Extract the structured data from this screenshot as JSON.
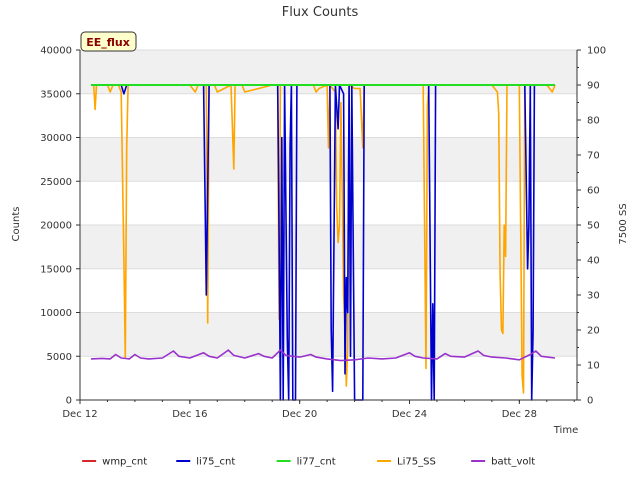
{
  "chart_data": {
    "type": "line",
    "title": "Flux Counts",
    "xlabel": "Time",
    "ylabel": "Counts",
    "y2label": "7500 SS",
    "badge": "EE_flux",
    "x_ticks": [
      "Dec 12",
      "Dec 16",
      "Dec 20",
      "Dec 24",
      "Dec 28"
    ],
    "y_ticks": [
      "0",
      "5000",
      "10000",
      "15000",
      "20000",
      "25000",
      "30000",
      "35000",
      "40000"
    ],
    "y2_ticks": [
      "0",
      "10",
      "20",
      "30",
      "40",
      "50",
      "60",
      "70",
      "80",
      "90",
      "100"
    ],
    "x_range_days": [
      "Dec 12",
      "Dec 30"
    ],
    "ylim": [
      0,
      40000
    ],
    "y2lim": [
      0,
      100
    ],
    "grid": true,
    "legend_position": "bottom",
    "series": [
      {
        "name": "wmp_cnt",
        "color": "#d62728",
        "axis": "left",
        "points": []
      },
      {
        "name": "li75_cnt",
        "color": "#0000cc",
        "axis": "left",
        "points": [
          [
            12.4,
            36000
          ],
          [
            13.5,
            36000
          ],
          [
            13.6,
            35000
          ],
          [
            13.7,
            36000
          ],
          [
            16.5,
            36000
          ],
          [
            16.6,
            12000
          ],
          [
            16.7,
            36000
          ],
          [
            19.2,
            36000
          ],
          [
            19.25,
            18500
          ],
          [
            19.3,
            0
          ],
          [
            19.35,
            30000
          ],
          [
            19.4,
            0
          ],
          [
            19.45,
            36000
          ],
          [
            19.55,
            7000
          ],
          [
            19.6,
            0
          ],
          [
            19.65,
            29000
          ],
          [
            19.7,
            36000
          ],
          [
            19.75,
            0
          ],
          [
            19.85,
            0
          ],
          [
            19.9,
            36000
          ],
          [
            21.1,
            36000
          ],
          [
            21.15,
            8000
          ],
          [
            21.2,
            1000
          ],
          [
            21.3,
            36000
          ],
          [
            21.4,
            31000
          ],
          [
            21.45,
            36000
          ],
          [
            21.6,
            35000
          ],
          [
            21.65,
            3000
          ],
          [
            21.7,
            14000
          ],
          [
            21.75,
            10000
          ],
          [
            21.8,
            36000
          ],
          [
            21.85,
            5000
          ],
          [
            21.9,
            36000
          ],
          [
            22.0,
            0
          ],
          [
            22.3,
            0
          ],
          [
            22.35,
            36000
          ],
          [
            24.7,
            36000
          ],
          [
            24.8,
            0
          ],
          [
            24.85,
            11000
          ],
          [
            24.9,
            0
          ],
          [
            24.95,
            36000
          ],
          [
            28.2,
            36000
          ],
          [
            28.3,
            15000
          ],
          [
            28.35,
            20000
          ],
          [
            28.4,
            36000
          ],
          [
            28.45,
            0
          ],
          [
            28.5,
            8000
          ],
          [
            28.55,
            36000
          ],
          [
            29.0,
            36000
          ]
        ]
      },
      {
        "name": "li77_cnt",
        "color": "#22dd22",
        "axis": "left",
        "points": [
          [
            12.4,
            36000
          ],
          [
            29.3,
            36000
          ]
        ]
      },
      {
        "name": "Li75_SS",
        "color": "#ffa500",
        "axis": "right",
        "points": [
          [
            12.4,
            90
          ],
          [
            12.5,
            90
          ],
          [
            12.55,
            83
          ],
          [
            12.6,
            90
          ],
          [
            13.0,
            90
          ],
          [
            13.1,
            88
          ],
          [
            13.2,
            90
          ],
          [
            13.4,
            90
          ],
          [
            13.5,
            88
          ],
          [
            13.6,
            40
          ],
          [
            13.65,
            12
          ],
          [
            13.7,
            72
          ],
          [
            13.75,
            90
          ],
          [
            14.5,
            90
          ],
          [
            15.5,
            90
          ],
          [
            16.0,
            90
          ],
          [
            16.2,
            88
          ],
          [
            16.3,
            90
          ],
          [
            16.6,
            90
          ],
          [
            16.65,
            22
          ],
          [
            16.7,
            90
          ],
          [
            16.9,
            90
          ],
          [
            17.0,
            88
          ],
          [
            17.5,
            90
          ],
          [
            17.6,
            66
          ],
          [
            17.65,
            90
          ],
          [
            17.9,
            90
          ],
          [
            18.0,
            88
          ],
          [
            19.0,
            90
          ],
          [
            19.2,
            90
          ],
          [
            19.25,
            23
          ],
          [
            19.3,
            90
          ],
          [
            20.0,
            90
          ],
          [
            20.5,
            90
          ],
          [
            20.6,
            88
          ],
          [
            20.7,
            89
          ],
          [
            21.0,
            90
          ],
          [
            21.05,
            72
          ],
          [
            21.1,
            90
          ],
          [
            21.3,
            88
          ],
          [
            21.35,
            55
          ],
          [
            21.4,
            45
          ],
          [
            21.45,
            50
          ],
          [
            21.5,
            85
          ],
          [
            21.55,
            60
          ],
          [
            21.6,
            30
          ],
          [
            21.65,
            20
          ],
          [
            21.7,
            4
          ],
          [
            21.75,
            15
          ],
          [
            21.8,
            90
          ],
          [
            22.0,
            89
          ],
          [
            22.2,
            89
          ],
          [
            22.3,
            72
          ],
          [
            22.35,
            90
          ],
          [
            23.0,
            90
          ],
          [
            24.0,
            90
          ],
          [
            24.5,
            90
          ],
          [
            24.6,
            9
          ],
          [
            24.65,
            84
          ],
          [
            24.7,
            90
          ],
          [
            27.0,
            90
          ],
          [
            27.2,
            88
          ],
          [
            27.25,
            82
          ],
          [
            27.3,
            36
          ],
          [
            27.35,
            20
          ],
          [
            27.4,
            19
          ],
          [
            27.45,
            50
          ],
          [
            27.5,
            41
          ],
          [
            27.55,
            90
          ],
          [
            28.0,
            90
          ],
          [
            28.1,
            7
          ],
          [
            28.15,
            2
          ],
          [
            28.2,
            90
          ],
          [
            28.4,
            90
          ],
          [
            28.6,
            90
          ],
          [
            29.0,
            90
          ],
          [
            29.2,
            88
          ],
          [
            29.3,
            90
          ]
        ]
      },
      {
        "name": "batt_volt",
        "color": "#9932cc",
        "axis": "left",
        "points": [
          [
            12.4,
            4700
          ],
          [
            12.8,
            4750
          ],
          [
            13.1,
            4700
          ],
          [
            13.3,
            5200
          ],
          [
            13.5,
            4800
          ],
          [
            13.8,
            4700
          ],
          [
            14.0,
            5200
          ],
          [
            14.2,
            4800
          ],
          [
            14.5,
            4700
          ],
          [
            15.0,
            4800
          ],
          [
            15.4,
            5600
          ],
          [
            15.6,
            5000
          ],
          [
            16.0,
            4800
          ],
          [
            16.5,
            5400
          ],
          [
            16.7,
            5000
          ],
          [
            17.0,
            4800
          ],
          [
            17.4,
            5700
          ],
          [
            17.6,
            5100
          ],
          [
            18.0,
            4800
          ],
          [
            18.5,
            5300
          ],
          [
            18.7,
            5000
          ],
          [
            19.0,
            4800
          ],
          [
            19.3,
            5700
          ],
          [
            19.5,
            5100
          ],
          [
            20.0,
            4900
          ],
          [
            20.4,
            5200
          ],
          [
            20.6,
            4900
          ],
          [
            21.0,
            4700
          ],
          [
            21.5,
            4500
          ],
          [
            22.0,
            4600
          ],
          [
            22.5,
            4800
          ],
          [
            23.0,
            4700
          ],
          [
            23.5,
            4800
          ],
          [
            24.0,
            5400
          ],
          [
            24.2,
            5000
          ],
          [
            24.5,
            4800
          ],
          [
            25.0,
            4700
          ],
          [
            25.3,
            5300
          ],
          [
            25.5,
            5000
          ],
          [
            26.0,
            4900
          ],
          [
            26.5,
            5600
          ],
          [
            26.7,
            5100
          ],
          [
            27.0,
            4900
          ],
          [
            27.5,
            4800
          ],
          [
            28.0,
            4600
          ],
          [
            28.4,
            5200
          ],
          [
            28.6,
            5600
          ],
          [
            28.8,
            5000
          ],
          [
            29.3,
            4800
          ]
        ]
      }
    ]
  }
}
